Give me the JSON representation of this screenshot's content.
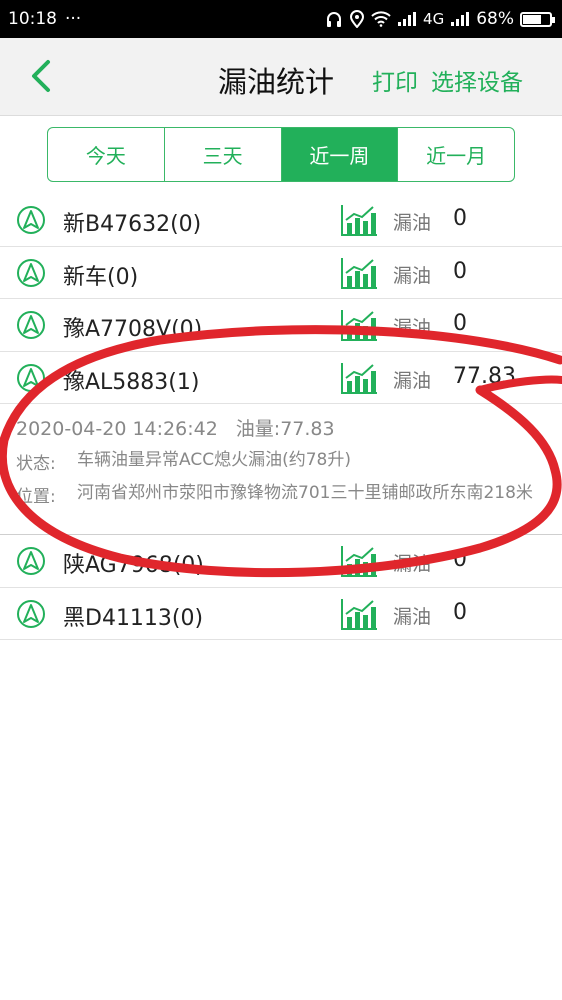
{
  "status_bar": {
    "time": "10:18",
    "dots": "···",
    "network": "4G",
    "battery": "68%",
    "battery_level": 0.68
  },
  "header": {
    "title": "漏油统计",
    "print": "打印",
    "choose_device": "选择设备"
  },
  "tabs": [
    {
      "label": "今天",
      "active": false
    },
    {
      "label": "三天",
      "active": false
    },
    {
      "label": "近一周",
      "active": true
    },
    {
      "label": "近一月",
      "active": false
    }
  ],
  "rows": [
    {
      "plate": "新B47632(0)",
      "label": "漏油",
      "value": "0"
    },
    {
      "plate": "新车(0)",
      "label": "漏油",
      "value": "0"
    },
    {
      "plate": "豫A7708V(0)",
      "label": "漏油",
      "value": "0"
    },
    {
      "plate": "豫AL5883(1)",
      "label": "漏油",
      "value": "77.83"
    },
    {
      "plate": "陕AG7968(0)",
      "label": "漏油",
      "value": "0"
    },
    {
      "plate": "黑D41113(0)",
      "label": "漏油",
      "value": "0"
    }
  ],
  "detail": {
    "datetime": "2020-04-20 14:26:42",
    "amount": "油量:77.83",
    "status_key": "状态:",
    "status_val": "车辆油量异常ACC熄火漏油(约78升)",
    "location_key": "位置:",
    "location_val": "河南省郑州市荥阳市豫锋物流701三十里铺邮政所东南218米"
  },
  "colors": {
    "accent": "#22b05a",
    "annotation": "#e0262c"
  },
  "icons": {
    "back": "chevron-left-icon",
    "nav": "navigation-arrow-icon",
    "chart": "bar-chart-icon",
    "signal": "signal-icon",
    "wifi": "wifi-icon",
    "location": "location-icon",
    "headphones": "headphones-icon"
  }
}
